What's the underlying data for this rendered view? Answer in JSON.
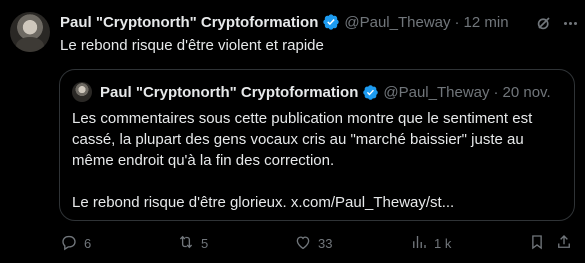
{
  "author": {
    "name": "Paul \"Cryptonorth\" Cryptoformation",
    "handle": "@Paul_Theway",
    "time": "12 min",
    "dot": "·"
  },
  "tweet_text": "Le rebond risque d'être violent et rapide",
  "quote": {
    "name": "Paul \"Cryptonorth\" Cryptoformation",
    "handle": "@Paul_Theway",
    "date": "20 nov.",
    "dot": "·",
    "line1": "Les commentaires sous cette publication montre que le sentiment est",
    "line2": "cassé, la plupart des gens vocaux cris au \"marché baissier\" juste au",
    "line3": "même endroit qu'à la fin des correction.",
    "line4": "Le rebond risque d'être glorieux. x.com/Paul_Theway/st..."
  },
  "actions": {
    "reply_count": "6",
    "retweet_count": "5",
    "like_count": "33",
    "views_count": "1 k"
  },
  "colors": {
    "background": "#000000",
    "text": "#e7e9ea",
    "muted": "#71767b",
    "verified": "#1d9bf0",
    "border": "#2f3336"
  },
  "icons": [
    "verified-badge-icon",
    "grok-icon",
    "more-icon",
    "reply-icon",
    "retweet-icon",
    "like-icon",
    "views-icon",
    "bookmark-icon",
    "share-icon"
  ]
}
